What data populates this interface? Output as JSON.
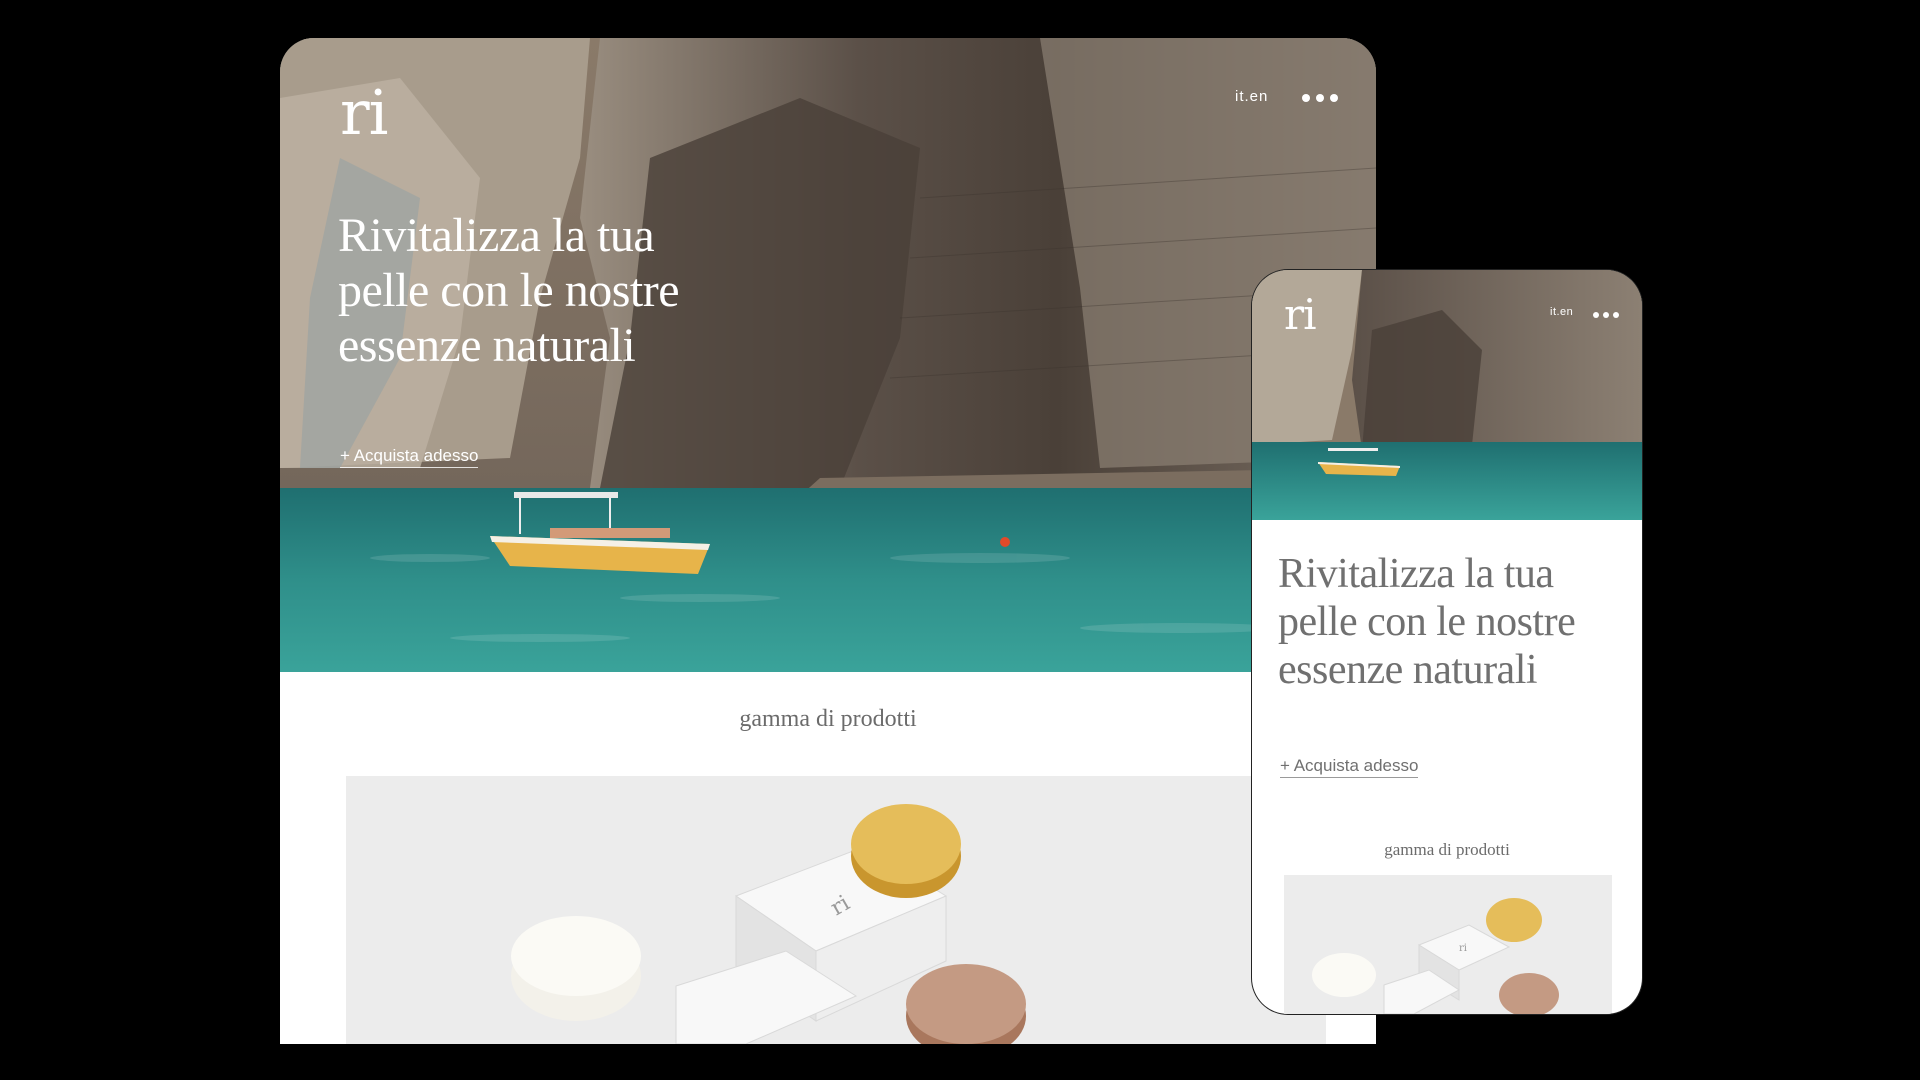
{
  "desktop": {
    "logo": "ri",
    "language_switch": "it.en",
    "menu_icon": "more-dots-icon",
    "headline": "Rivitalizza la tua pelle con le nostre essenze naturali",
    "cta_label": "+ Acquista adesso",
    "products_section_title": "gamma di prodotti",
    "box_mark": "ri"
  },
  "mobile": {
    "logo": "ri",
    "language_switch": "it.en",
    "menu_icon": "more-dots-icon",
    "headline": "Rivitalizza la tua pelle con le nostre essenze naturali",
    "cta_label": "+ Acquista adesso",
    "products_section_title": "gamma di prodotti",
    "box_mark": "ri"
  },
  "colors": {
    "background": "#000000",
    "page": "#ffffff",
    "sea": "#2f8a88",
    "rock": "#5a5148",
    "muted_text": "#707070",
    "product_bg": "#ececec"
  }
}
